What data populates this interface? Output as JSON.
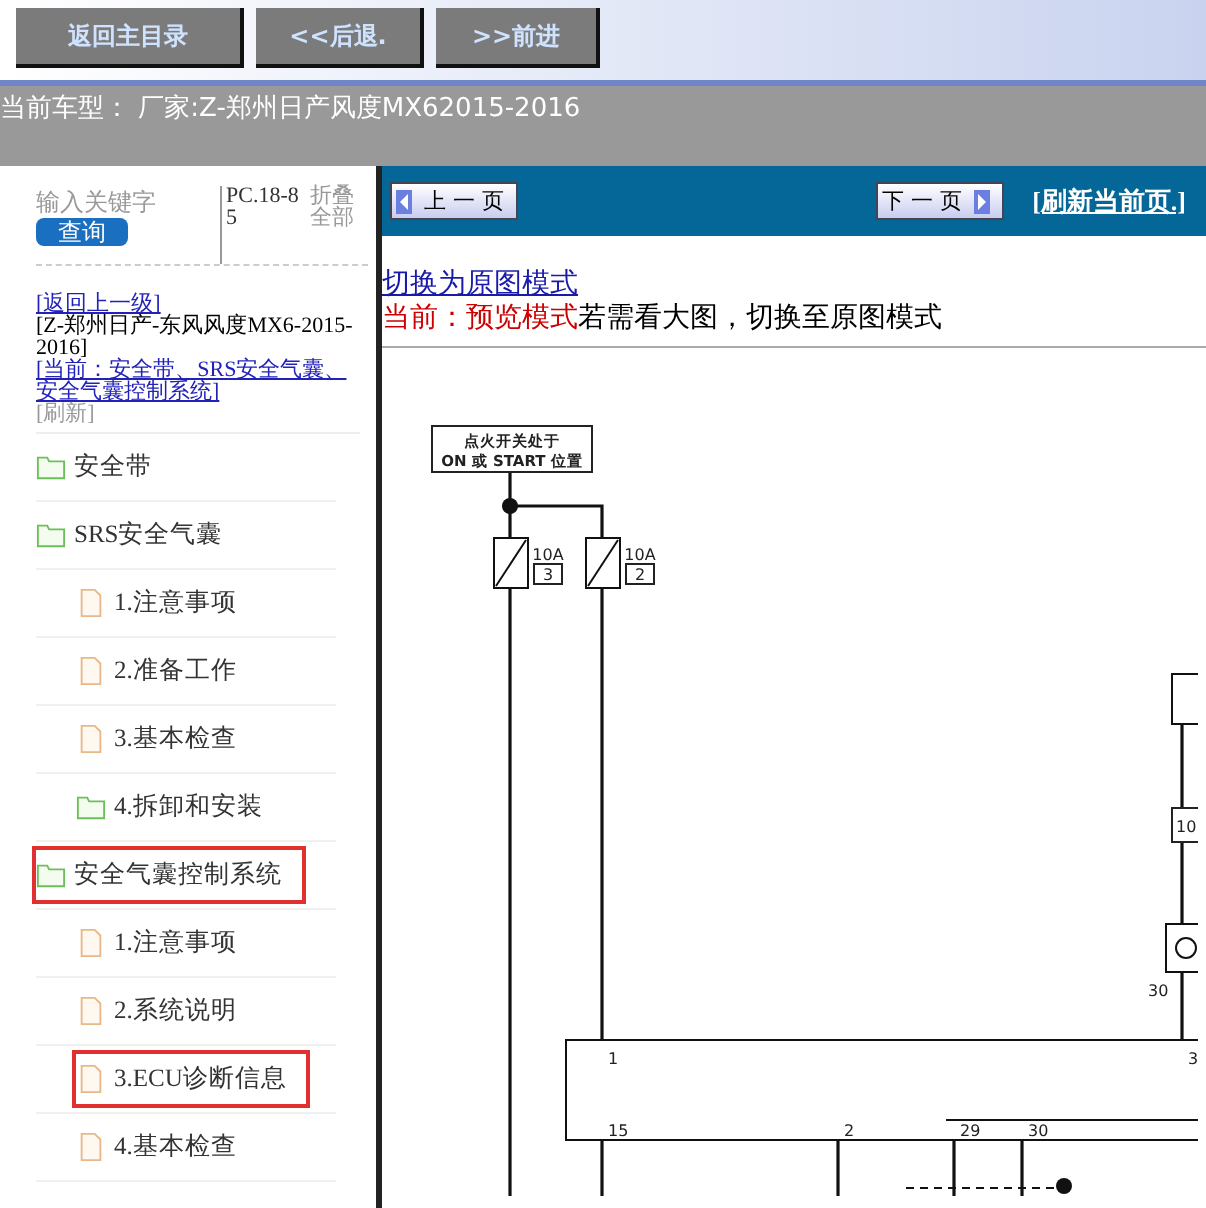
{
  "toolbar": {
    "buttons": [
      "返回主目录",
      "<<后退.",
      ">>前进"
    ]
  },
  "model_bar": {
    "text": "当前车型： 厂家:Z-郑州日产风度MX62015-2016"
  },
  "sidebar": {
    "search": {
      "placeholder": "输入关键字",
      "button": "查询"
    },
    "code": "PC.18-85",
    "collapse_all": "折叠全部",
    "breadcrumb": {
      "back": "[返回上一级]",
      "model": "[Z-郑州日产-东风风度MX6-2015-2016]",
      "current": "[当前：安全带、SRS安全气囊、安全气囊控制系统]",
      "refresh": "[刷新]"
    },
    "tree": [
      {
        "label": "安全带",
        "kind": "folder",
        "highlighted": false
      },
      {
        "label": "SRS安全气囊",
        "kind": "folder",
        "highlighted": false,
        "children": [
          {
            "label": "1.注意事项",
            "kind": "doc",
            "highlighted": false
          },
          {
            "label": "2.准备工作",
            "kind": "doc",
            "highlighted": false
          },
          {
            "label": "3.基本检查",
            "kind": "doc",
            "highlighted": false
          },
          {
            "label": "4.拆卸和安装",
            "kind": "folder",
            "highlighted": false
          }
        ]
      },
      {
        "label": "安全气囊控制系统",
        "kind": "folder",
        "highlighted": true,
        "children": [
          {
            "label": "1.注意事项",
            "kind": "doc",
            "highlighted": false
          },
          {
            "label": "2.系统说明",
            "kind": "doc",
            "highlighted": false
          },
          {
            "label": "3.ECU诊断信息",
            "kind": "doc",
            "highlighted": true
          },
          {
            "label": "4.基本检查",
            "kind": "doc",
            "highlighted": false
          }
        ]
      }
    ]
  },
  "pager": {
    "prev": "上 一 页",
    "next": "下 一 页",
    "refresh": "[刷新当前页.]"
  },
  "mode": {
    "switch_link": "切换为原图模式",
    "current": "当前：预览模式",
    "hint": "若需看大图，切换至原图模式"
  },
  "diagram": {
    "switch_label": [
      "点火开关处于",
      "ON 或 START 位置"
    ],
    "fuses": [
      {
        "rating": "10A",
        "number": "3"
      },
      {
        "rating": "10A",
        "number": "2"
      }
    ],
    "pins": [
      "1",
      "3",
      "15",
      "2",
      "29",
      "30"
    ],
    "side_labels": [
      "10",
      "30"
    ]
  }
}
